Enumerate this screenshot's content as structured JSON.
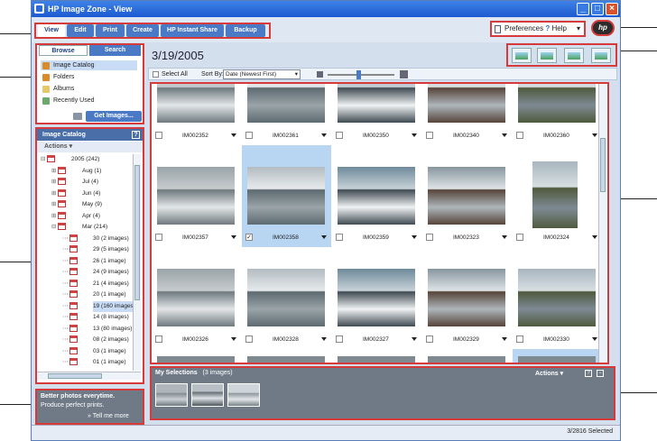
{
  "window": {
    "title": "HP Image Zone - View"
  },
  "tabs": [
    "View",
    "Edit",
    "Print",
    "Create",
    "HP Instant Share",
    "Backup"
  ],
  "header": {
    "preferences": "Preferences",
    "help": "Help",
    "logo": "hp"
  },
  "left": {
    "tabs": [
      "Browse",
      "Search"
    ],
    "nav": [
      "Image Catalog",
      "Folders",
      "Albums",
      "Recently Used"
    ],
    "get_images": "Get Images...",
    "catalog_title": "Image Catalog",
    "catalog_help": "?",
    "actions": "Actions",
    "tree": [
      {
        "label": "2005 (242)",
        "level": 0,
        "sel": false
      },
      {
        "label": "Aug (1)",
        "level": 1,
        "sel": false
      },
      {
        "label": "Jul (4)",
        "level": 1,
        "sel": false
      },
      {
        "label": "Jun (4)",
        "level": 1,
        "sel": false
      },
      {
        "label": "May (9)",
        "level": 1,
        "sel": false
      },
      {
        "label": "Apr (4)",
        "level": 1,
        "sel": false
      },
      {
        "label": "Mar (214)",
        "level": 1,
        "sel": false
      },
      {
        "label": "30 (2 images)",
        "level": 2,
        "sel": false
      },
      {
        "label": "29 (5 images)",
        "level": 2,
        "sel": false
      },
      {
        "label": "26 (1 image)",
        "level": 2,
        "sel": false
      },
      {
        "label": "24 (9 images)",
        "level": 2,
        "sel": false
      },
      {
        "label": "21 (4 images)",
        "level": 2,
        "sel": false
      },
      {
        "label": "20 (1 image)",
        "level": 2,
        "sel": false
      },
      {
        "label": "19 (160 images)",
        "level": 2,
        "sel": true
      },
      {
        "label": "14 (8 images)",
        "level": 2,
        "sel": false
      },
      {
        "label": "13 (80 images)",
        "level": 2,
        "sel": false
      },
      {
        "label": "08 (2 images)",
        "level": 2,
        "sel": false
      },
      {
        "label": "03 (1 image)",
        "level": 2,
        "sel": false
      },
      {
        "label": "01 (1 image)",
        "level": 2,
        "sel": false
      }
    ],
    "promo": {
      "line1": "Better photos everytime.",
      "line2": "Produce perfect prints.",
      "link": "» Tell me more"
    }
  },
  "main": {
    "date": "3/19/2005",
    "select_all": "Select All",
    "sort_by": "Sort By:",
    "sort_value": "Date (Newest First)",
    "rows": [
      [
        "IM002352",
        "IM002361",
        "IM002350",
        "IM002340",
        "IM002360"
      ],
      [
        "IM002357",
        "IM002358",
        "IM002359",
        "IM002323",
        "IM002324"
      ],
      [
        "IM002326",
        "IM002328",
        "IM002327",
        "IM002329",
        "IM002330"
      ]
    ],
    "selected_item": "IM002358",
    "my_selections": "My Selections",
    "my_selections_count": "(3 images)",
    "my_actions": "Actions"
  },
  "status": "3/2816 Selected"
}
